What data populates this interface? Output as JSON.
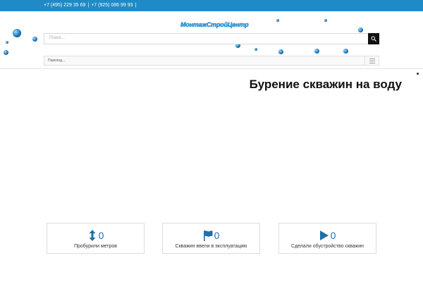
{
  "topbar": {
    "phone1": "+7 (495) 229 35 69",
    "separator": "|",
    "phone2": "+7 (925) 086 99 93",
    "separator2": "|"
  },
  "header": {
    "logo": "МонтажСтройЦентр",
    "search_placeholder": "Поиск ...",
    "menu_label": "Переход..."
  },
  "main": {
    "heading": "Бурение скважин на воду"
  },
  "stats": [
    {
      "icon": "vertical-arrows-icon",
      "value": "0",
      "caption": "Пробурили метров"
    },
    {
      "icon": "flag-icon",
      "value": "0",
      "caption": "Скважин ввели в эксплуатацию"
    },
    {
      "icon": "play-icon",
      "value": "0",
      "caption": "Сделали обустройство скважин"
    }
  ],
  "colors": {
    "topbar": "#1f8ac6",
    "accent": "#1f6fa8",
    "logo": "#1a95e0",
    "search_button": "#111111"
  }
}
